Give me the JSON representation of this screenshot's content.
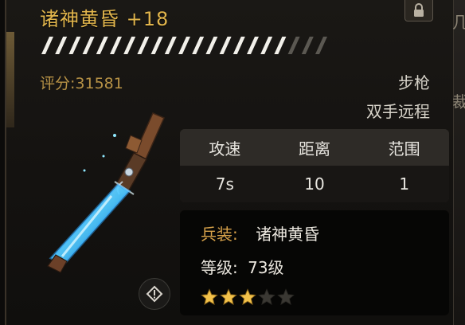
{
  "item": {
    "name": "诸神黄昏",
    "level_bonus": "+18",
    "score_label": "评分:",
    "score_value": "31581",
    "weapon_type": "步枪",
    "weapon_handling": "双手远程"
  },
  "stats": {
    "headers": [
      "攻速",
      "距离",
      "范围"
    ],
    "values": [
      "7s",
      "10",
      "1"
    ]
  },
  "details": {
    "equip_label": "兵装:",
    "equip_value": "诸神黄昏",
    "grade_label": "等级:",
    "grade_value": "73级"
  },
  "rating": {
    "filled": 3,
    "total": 5
  },
  "enhance_progress": {
    "filled_segments": 18,
    "total_segments": 21
  },
  "colors": {
    "title_gold": "#e1b54c",
    "accent_orange": "#d7a24a",
    "weapon_glow": "#5fd6ff",
    "star_gold": "#f2c14a",
    "star_dim": "#3a3833"
  },
  "icons": {
    "lock": "lock-icon",
    "warning": "warning-icon",
    "weapon": "rifle-image"
  },
  "side_glyphs": [
    "几",
    "裁"
  ]
}
